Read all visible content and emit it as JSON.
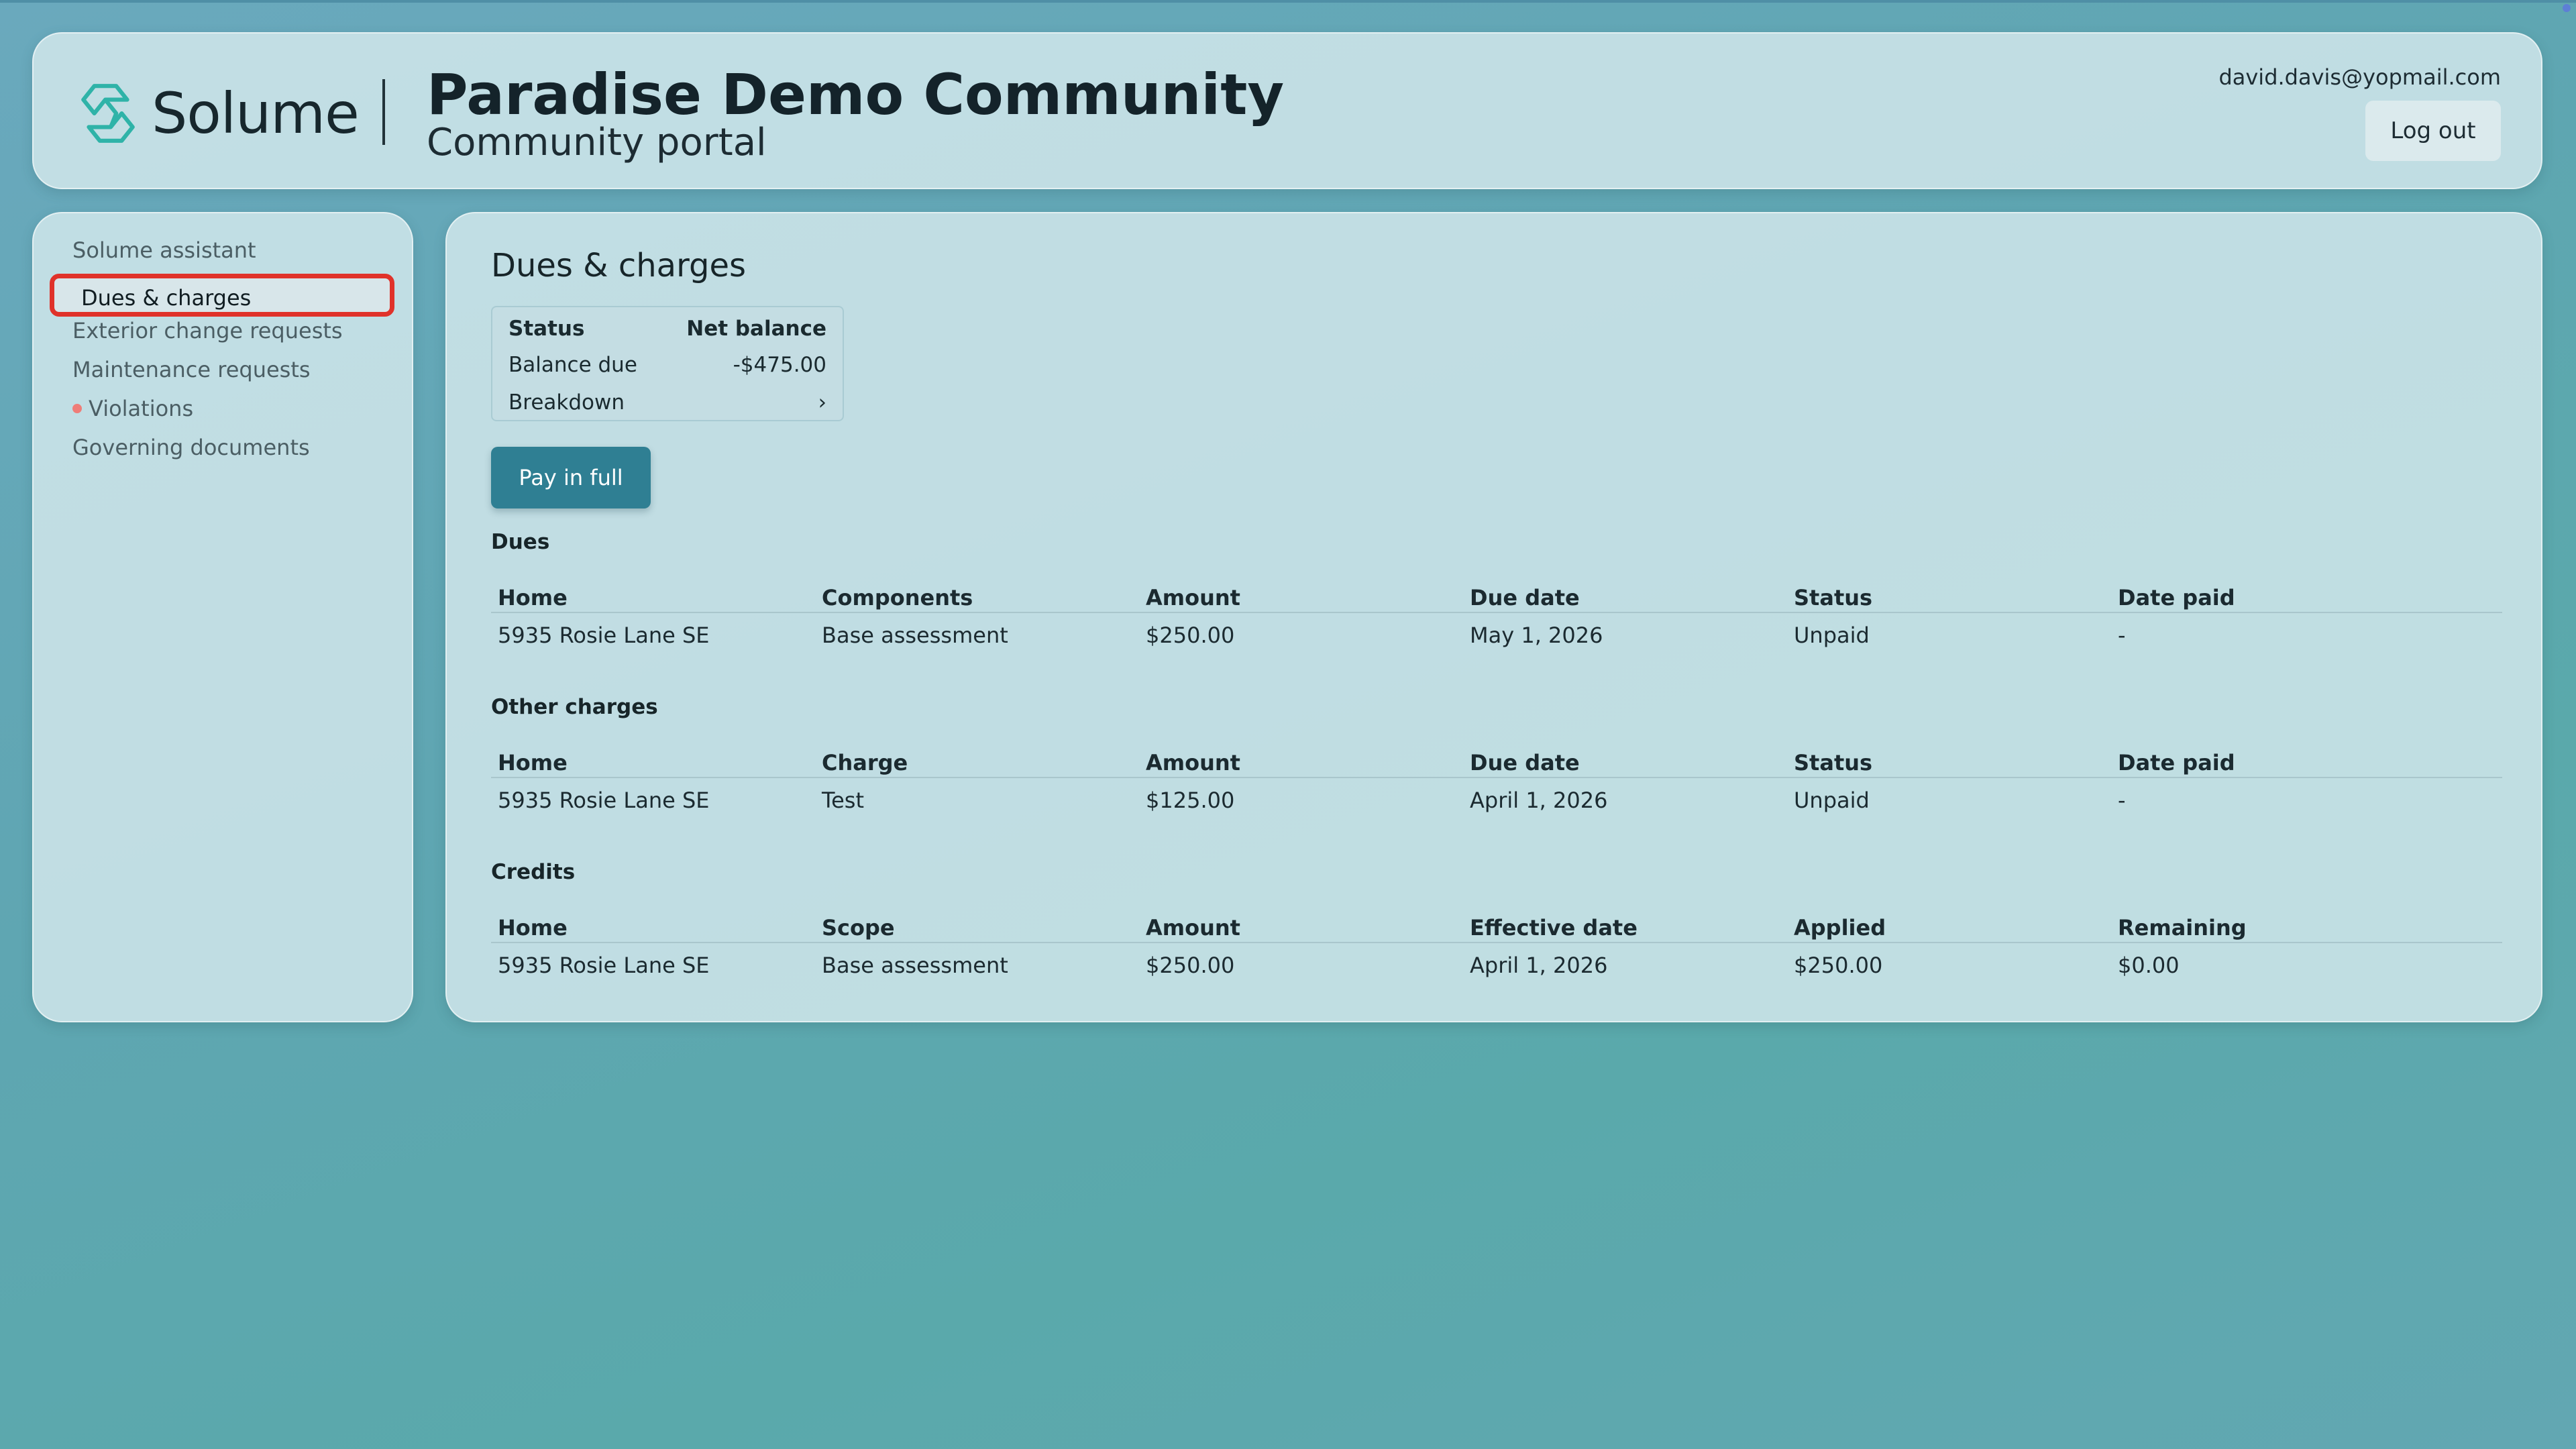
{
  "brand": {
    "name": "Solume",
    "logo_icon": "solume-logo-icon",
    "accent": "#2fb3a8"
  },
  "header": {
    "community_title": "Paradise Demo Community",
    "community_subtitle": "Community portal",
    "user_email": "david.davis@yopmail.com",
    "logout_label": "Log out"
  },
  "sidebar": {
    "items": [
      {
        "label": "Solume assistant"
      },
      {
        "label": "Dues & charges",
        "active": true
      },
      {
        "label": "Exterior change requests"
      },
      {
        "label": "Maintenance requests"
      },
      {
        "label": "Violations",
        "badge_color": "#ef7d78"
      },
      {
        "label": "Governing documents"
      }
    ]
  },
  "main": {
    "title": "Dues & charges",
    "balance": {
      "status_label": "Status",
      "net_balance_label": "Net balance",
      "balance_due_label": "Balance due",
      "balance_due_value": "-$475.00",
      "breakdown_label": "Breakdown",
      "chevron": "›"
    },
    "pay_label": "Pay in full",
    "dues": {
      "title": "Dues",
      "columns": [
        "Home",
        "Components",
        "Amount",
        "Due date",
        "Status",
        "Date paid"
      ],
      "rows": [
        [
          "5935 Rosie Lane SE",
          "Base assessment",
          "$250.00",
          "May 1, 2026",
          "Unpaid",
          "-"
        ]
      ]
    },
    "other_charges": {
      "title": "Other charges",
      "columns": [
        "Home",
        "Charge",
        "Amount",
        "Due date",
        "Status",
        "Date paid"
      ],
      "rows": [
        [
          "5935 Rosie Lane SE",
          "Test",
          "$125.00",
          "April 1, 2026",
          "Unpaid",
          "-"
        ]
      ]
    },
    "credits": {
      "title": "Credits",
      "columns": [
        "Home",
        "Scope",
        "Amount",
        "Effective date",
        "Applied",
        "Remaining"
      ],
      "rows": [
        [
          "5935 Rosie Lane SE",
          "Base assessment",
          "$250.00",
          "April 1, 2026",
          "$250.00",
          "$0.00"
        ]
      ]
    }
  }
}
